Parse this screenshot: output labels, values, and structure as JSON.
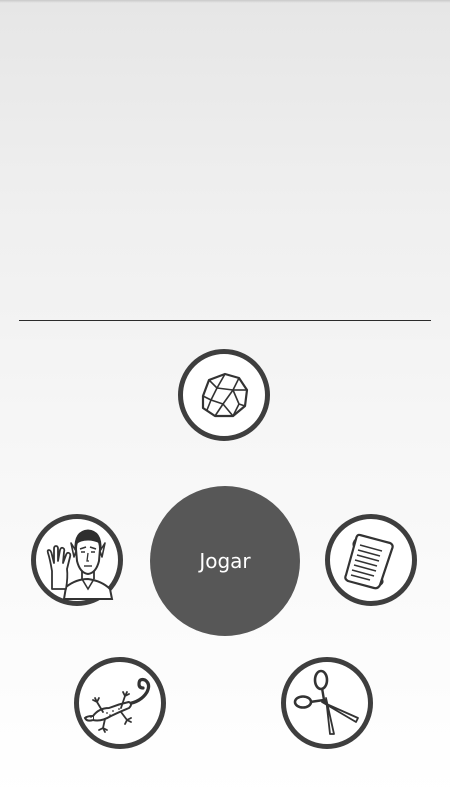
{
  "game": {
    "play_label": "Jogar",
    "choices": [
      {
        "id": "rock",
        "icon": "rock-icon"
      },
      {
        "id": "paper",
        "icon": "paper-icon"
      },
      {
        "id": "scissors",
        "icon": "scissors-icon"
      },
      {
        "id": "lizard",
        "icon": "lizard-icon"
      },
      {
        "id": "spock",
        "icon": "spock-icon"
      }
    ]
  },
  "colors": {
    "ring": "#3e3e3e",
    "button": "#575757",
    "divider": "#2b2b2b",
    "background_top": "#e6e6e6",
    "background_bottom": "#ffffff"
  }
}
